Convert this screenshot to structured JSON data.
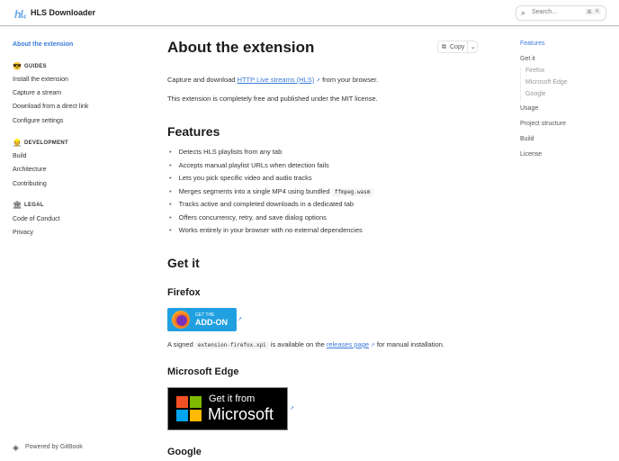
{
  "header": {
    "logo": "hl₄",
    "title": "HLS Downloader",
    "search_placeholder": "Search...",
    "shortcut": [
      "⌘",
      "K"
    ]
  },
  "sidebar": {
    "active": "About the extension",
    "sections": [
      {
        "emoji": "😎",
        "title": "GUIDES",
        "items": [
          "Install the extension",
          "Capture a stream",
          "Download from a direct link",
          "Configure settings"
        ]
      },
      {
        "emoji": "👷",
        "title": "DEVELOPMENT",
        "items": [
          "Build",
          "Architecture",
          "Contributing"
        ]
      },
      {
        "emoji": "🏛",
        "title": "LEGAL",
        "items": [
          "Code of Conduct",
          "Privacy"
        ]
      }
    ],
    "footer": "Powered by GitBook"
  },
  "main": {
    "title": "About the extension",
    "copy_label": "Copy",
    "intro_pre": "Capture and download ",
    "intro_link": "HTTP Live streams (HLS)",
    "intro_post": " from your browser.",
    "license_text": "This extension is completely free and published under the MIT license.",
    "features_title": "Features",
    "features": [
      "Detects HLS playlists from any tab",
      "Accepts manual playlist URLs when detection fails",
      "Lets you pick specific video and audio tracks",
      "Merges segments into a single MP4 using bundled ",
      "Tracks active and completed downloads in a dedicated tab",
      "Offers concurrency, retry, and save dialog options",
      "Works entirely in your browser with no external dependencies"
    ],
    "features_code": "ffmpeg.wasm",
    "getit_title": "Get it",
    "firefox_title": "Firefox",
    "ff_badge": {
      "line1": "GET THE",
      "line2": "ADD-ON"
    },
    "signed_pre": "A signed ",
    "signed_code": "extension-firefox.xpi",
    "signed_mid": " is available on the ",
    "signed_link": "releases page",
    "signed_post": " for manual installation.",
    "edge_title": "Microsoft Edge",
    "ms_badge": {
      "line1": "Get it from",
      "line2": "Microsoft"
    },
    "google_title": "Google"
  },
  "toc": {
    "items": [
      "Features",
      "Get it",
      "Firefox",
      "Microsoft Edge",
      "Google",
      "Usage",
      "Project structure",
      "Build",
      "License"
    ]
  }
}
